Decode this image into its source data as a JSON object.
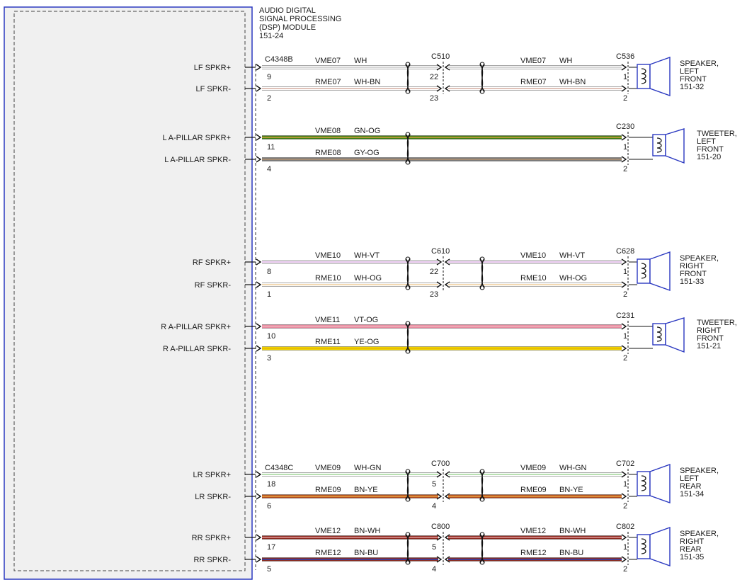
{
  "module": {
    "name_lines": [
      "AUDIO DIGITAL",
      "SIGNAL PROCESSING",
      "(DSP) MODULE",
      "151-24"
    ],
    "connector_a": "C4348B",
    "connector_c": "C4348C"
  },
  "circuits": [
    {
      "id": "lf",
      "inline_connector": "C510",
      "device_connector": "C536",
      "device_lines": [
        "SPEAKER,",
        "LEFT",
        "FRONT",
        "151-32"
      ],
      "device_type": "speaker",
      "wires": [
        {
          "pin_label": "LF SPKR+",
          "module_pin": "9",
          "inline_pin": "22",
          "device_pin": "1",
          "circuit": "VME07",
          "color": "WH",
          "stripe": [
            "#ffffff",
            "#cccccc"
          ]
        },
        {
          "pin_label": "LF SPKR-",
          "module_pin": "2",
          "inline_pin": "23",
          "device_pin": "2",
          "circuit": "RME07",
          "color": "WH-BN",
          "stripe": [
            "#ffffff",
            "#d8b4a8"
          ]
        }
      ]
    },
    {
      "id": "lap",
      "inline_connector": "",
      "device_connector": "C230",
      "device_lines": [
        "TWEETER,",
        "LEFT",
        "FRONT",
        "151-20"
      ],
      "device_type": "tweeter",
      "wires": [
        {
          "pin_label": "L A-PILLAR SPKR+",
          "module_pin": "11",
          "inline_pin": "",
          "device_pin": "1",
          "circuit": "VME08",
          "color": "GN-OG",
          "stripe": [
            "#3c7c10",
            "#c8a040"
          ]
        },
        {
          "pin_label": "L A-PILLAR SPKR-",
          "module_pin": "4",
          "inline_pin": "",
          "device_pin": "2",
          "circuit": "RME08",
          "color": "GY-OG",
          "stripe": [
            "#7a7a7a",
            "#b09070"
          ]
        }
      ]
    },
    {
      "id": "rf",
      "inline_connector": "C610",
      "device_connector": "C628",
      "device_lines": [
        "SPEAKER,",
        "RIGHT",
        "FRONT",
        "151-33"
      ],
      "device_type": "speaker",
      "wires": [
        {
          "pin_label": "RF SPKR+",
          "module_pin": "8",
          "inline_pin": "22",
          "device_pin": "1",
          "circuit": "VME10",
          "color": "WH-VT",
          "stripe": [
            "#ffffff",
            "#d8b0e0"
          ]
        },
        {
          "pin_label": "RF SPKR-",
          "module_pin": "1",
          "inline_pin": "23",
          "device_pin": "2",
          "circuit": "RME10",
          "color": "WH-OG",
          "stripe": [
            "#ffffff",
            "#f0d0a0"
          ]
        }
      ]
    },
    {
      "id": "rap",
      "inline_connector": "",
      "device_connector": "C231",
      "device_lines": [
        "TWEETER,",
        "RIGHT",
        "FRONT",
        "151-21"
      ],
      "device_type": "tweeter",
      "wires": [
        {
          "pin_label": "R A-PILLAR SPKR+",
          "module_pin": "10",
          "inline_pin": "",
          "device_pin": "1",
          "circuit": "VME11",
          "color": "VT-OG",
          "stripe": [
            "#e88aa0",
            "#f0b0b8"
          ]
        },
        {
          "pin_label": "R A-PILLAR SPKR-",
          "module_pin": "3",
          "inline_pin": "",
          "device_pin": "2",
          "circuit": "RME11",
          "color": "YE-OG",
          "stripe": [
            "#f2d600",
            "#e8b800"
          ]
        }
      ]
    },
    {
      "id": "lr",
      "inline_connector": "C700",
      "device_connector": "C702",
      "device_lines": [
        "SPEAKER,",
        "LEFT",
        "REAR",
        "151-34"
      ],
      "device_type": "speaker",
      "wires": [
        {
          "pin_label": "LR SPKR+",
          "module_pin": "18",
          "inline_pin": "5",
          "device_pin": "1",
          "circuit": "VME09",
          "color": "WH-GN",
          "stripe": [
            "#ffffff",
            "#a8d8a0"
          ]
        },
        {
          "pin_label": "LR SPKR-",
          "module_pin": "6",
          "inline_pin": "4",
          "device_pin": "2",
          "circuit": "RME09",
          "color": "BN-YE",
          "stripe": [
            "#b04a1c",
            "#e8a040"
          ]
        }
      ]
    },
    {
      "id": "rr",
      "inline_connector": "C800",
      "device_connector": "C802",
      "device_lines": [
        "SPEAKER,",
        "RIGHT",
        "REAR",
        "151-35"
      ],
      "device_type": "speaker",
      "wires": [
        {
          "pin_label": "RR SPKR+",
          "module_pin": "17",
          "inline_pin": "5",
          "device_pin": "1",
          "circuit": "VME12",
          "color": "BN-WH",
          "stripe": [
            "#8a2a20",
            "#e09090"
          ]
        },
        {
          "pin_label": "RR SPKR-",
          "module_pin": "5",
          "inline_pin": "4",
          "device_pin": "2",
          "circuit": "RME12",
          "color": "BN-BU",
          "stripe": [
            "#8a2a20",
            "#3040b0"
          ]
        }
      ]
    }
  ]
}
